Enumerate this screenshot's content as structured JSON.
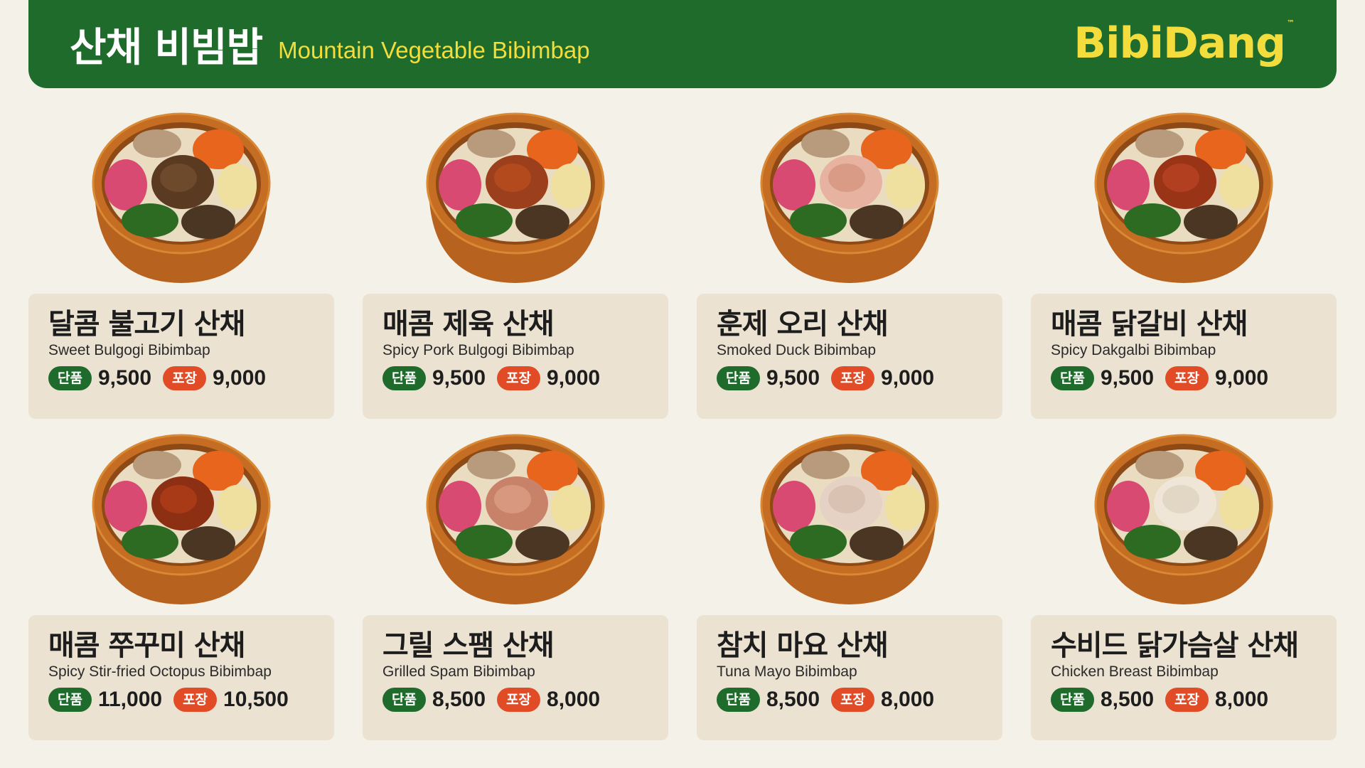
{
  "header": {
    "title_ko": "산채 비빔밥",
    "title_en": "Mountain Vegetable Bibimbap",
    "logo": "BibiDang",
    "logo_tm": "™"
  },
  "labels": {
    "single": "단품",
    "takeout": "포장"
  },
  "colors": {
    "header_bg": "#1f6b2c",
    "accent_yellow": "#f2dd3d",
    "single_badge": "#1f6b2c",
    "takeout_badge": "#e14c27",
    "card_bg": "#ebe2d2",
    "page_bg": "#f4f2e8"
  },
  "items": [
    {
      "name_ko": "달콤 불고기 산채",
      "name_en": "Sweet Bulgogi Bibimbap",
      "single_price": "9,500",
      "takeout_price": "9,000",
      "topping": "bulgogi"
    },
    {
      "name_ko": "매콤 제육 산채",
      "name_en": "Spicy Pork Bulgogi Bibimbap",
      "single_price": "9,500",
      "takeout_price": "9,000",
      "topping": "spicy-pork"
    },
    {
      "name_ko": "훈제 오리 산채",
      "name_en": "Smoked Duck Bibimbap",
      "single_price": "9,500",
      "takeout_price": "9,000",
      "topping": "smoked-duck"
    },
    {
      "name_ko": "매콤 닭갈비 산채",
      "name_en": "Spicy Dakgalbi Bibimbap",
      "single_price": "9,500",
      "takeout_price": "9,000",
      "topping": "dakgalbi"
    },
    {
      "name_ko": "매콤 쭈꾸미 산채",
      "name_en": "Spicy Stir-fried Octopus Bibimbap",
      "single_price": "11,000",
      "takeout_price": "10,500",
      "topping": "octopus"
    },
    {
      "name_ko": "그릴 스팸 산채",
      "name_en": "Grilled Spam Bibimbap",
      "single_price": "8,500",
      "takeout_price": "8,000",
      "topping": "spam"
    },
    {
      "name_ko": "참치 마요 산채",
      "name_en": "Tuna Mayo Bibimbap",
      "single_price": "8,500",
      "takeout_price": "8,000",
      "topping": "tuna-mayo"
    },
    {
      "name_ko": "수비드 닭가슴살 산채",
      "name_en": "Chicken Breast Bibimbap",
      "single_price": "8,500",
      "takeout_price": "8,000",
      "topping": "chicken-breast"
    }
  ]
}
